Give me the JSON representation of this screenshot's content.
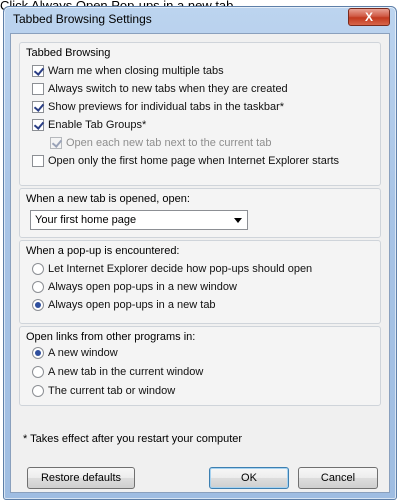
{
  "caption": "Click Always Open Pop-ups in a new tab",
  "window": {
    "title": "Tabbed Browsing Settings",
    "close_icon": "close-icon",
    "close_glyph": "X"
  },
  "tabbed_browsing": {
    "label": "Tabbed Browsing",
    "items": [
      {
        "label": "Warn me when closing multiple tabs",
        "checked": true
      },
      {
        "label": "Always switch to new tabs when they are created",
        "checked": false
      },
      {
        "label": "Show previews for individual tabs in the taskbar*",
        "checked": true
      },
      {
        "label": "Enable Tab Groups*",
        "checked": true
      },
      {
        "label": "Open each new tab next to the current tab",
        "checked": true,
        "disabled": true
      },
      {
        "label": "Open only the first home page when Internet Explorer starts",
        "checked": false
      }
    ]
  },
  "new_tab": {
    "label": "When a new tab is opened, open:",
    "selected": "Your first home page"
  },
  "popup": {
    "label": "When a pop-up is encountered:",
    "options": [
      {
        "label": "Let Internet Explorer decide how pop-ups should open",
        "checked": false
      },
      {
        "label": "Always open pop-ups in a new window",
        "checked": false
      },
      {
        "label": "Always open pop-ups in a new tab",
        "checked": true
      }
    ]
  },
  "links": {
    "label": "Open links from other programs in:",
    "options": [
      {
        "label": "A new window",
        "checked": true
      },
      {
        "label": "A new tab in the current window",
        "checked": false
      },
      {
        "label": "The current tab or window",
        "checked": false
      }
    ]
  },
  "footnote": "* Takes effect after you restart your computer",
  "buttons": {
    "restore": "Restore defaults",
    "ok": "OK",
    "cancel": "Cancel"
  }
}
